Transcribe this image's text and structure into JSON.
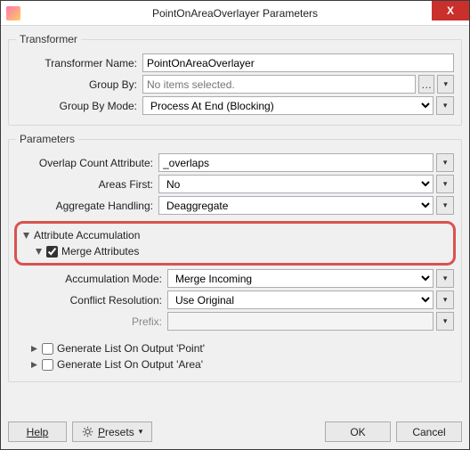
{
  "window": {
    "title": "PointOnAreaOverlayer Parameters",
    "close": "X"
  },
  "transformer": {
    "legend": "Transformer",
    "name_label": "Transformer Name:",
    "name_value": "PointOnAreaOverlayer",
    "groupby_label": "Group By:",
    "groupby_placeholder": "No items selected.",
    "groupbymode_label": "Group By Mode:",
    "groupbymode_value": "Process At End (Blocking)"
  },
  "params": {
    "legend": "Parameters",
    "overlap_label": "Overlap Count Attribute:",
    "overlap_value": "_overlaps",
    "areasfirst_label": "Areas First:",
    "areasfirst_value": "No",
    "agg_label": "Aggregate Handling:",
    "agg_value": "Deaggregate",
    "attr_accum": "Attribute Accumulation",
    "merge_attrs": "Merge Attributes",
    "accum_mode_label": "Accumulation Mode:",
    "accum_mode_value": "Merge Incoming",
    "conflict_label": "Conflict Resolution:",
    "conflict_value": "Use Original",
    "prefix_label": "Prefix:",
    "prefix_value": "",
    "gen_point": "Generate List On Output 'Point'",
    "gen_area": "Generate List On Output 'Area'"
  },
  "buttons": {
    "help": "Help",
    "presets": "Presets",
    "ok": "OK",
    "cancel": "Cancel"
  }
}
